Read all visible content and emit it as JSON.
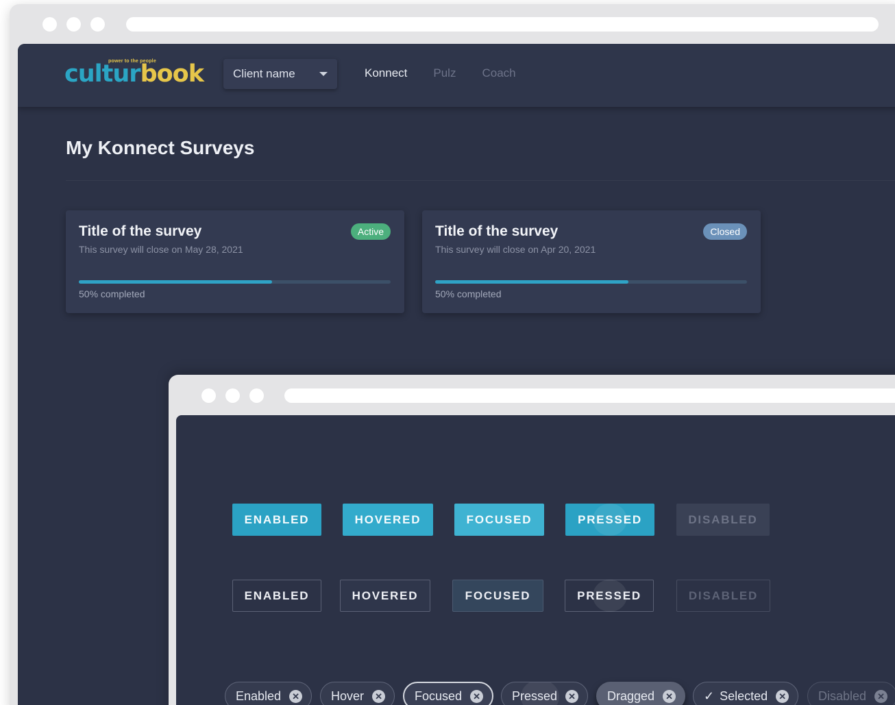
{
  "app": {
    "logo": {
      "word_a": "cultur",
      "word_b": "book",
      "tagline": "power to the people"
    },
    "client_select": {
      "value": "Client name"
    },
    "nav": [
      {
        "label": "Konnect",
        "active": true
      },
      {
        "label": "Pulz",
        "active": false
      },
      {
        "label": "Coach",
        "active": false
      }
    ],
    "page_title": "My Konnect Surveys",
    "surveys": [
      {
        "title": "Title of the survey",
        "subtitle": "This survey will close on May 28, 2021",
        "status": "Active",
        "progress": 0.62,
        "progress_label": "50% completed"
      },
      {
        "title": "Title of the survey",
        "subtitle": "This survey will close on Apr 20, 2021",
        "status": "Closed",
        "progress": 0.62,
        "progress_label": "50% completed"
      }
    ]
  },
  "buttons_filled": [
    "ENABLED",
    "HOVERED",
    "FOCUSED",
    "PRESSED",
    "DISABLED"
  ],
  "buttons_outline": [
    "ENABLED",
    "HOVERED",
    "FOCUSED",
    "PRESSED",
    "DISABLED"
  ],
  "chips": [
    "Enabled",
    "Hover",
    "Focused",
    "Pressed",
    "Dragged",
    "Selected",
    "Disabled"
  ],
  "colors": {
    "background": "#2c3246",
    "accent": "#2ba2c4",
    "logo_blue": "#2ba5c4",
    "logo_yellow": "#e6c64a",
    "badge_active": "#4caf7d",
    "badge_closed": "#6b91b9"
  },
  "icons": {
    "dropdown": "caret-down-icon",
    "chip_remove": "close-circle-icon",
    "chip_selected": "check-icon"
  }
}
